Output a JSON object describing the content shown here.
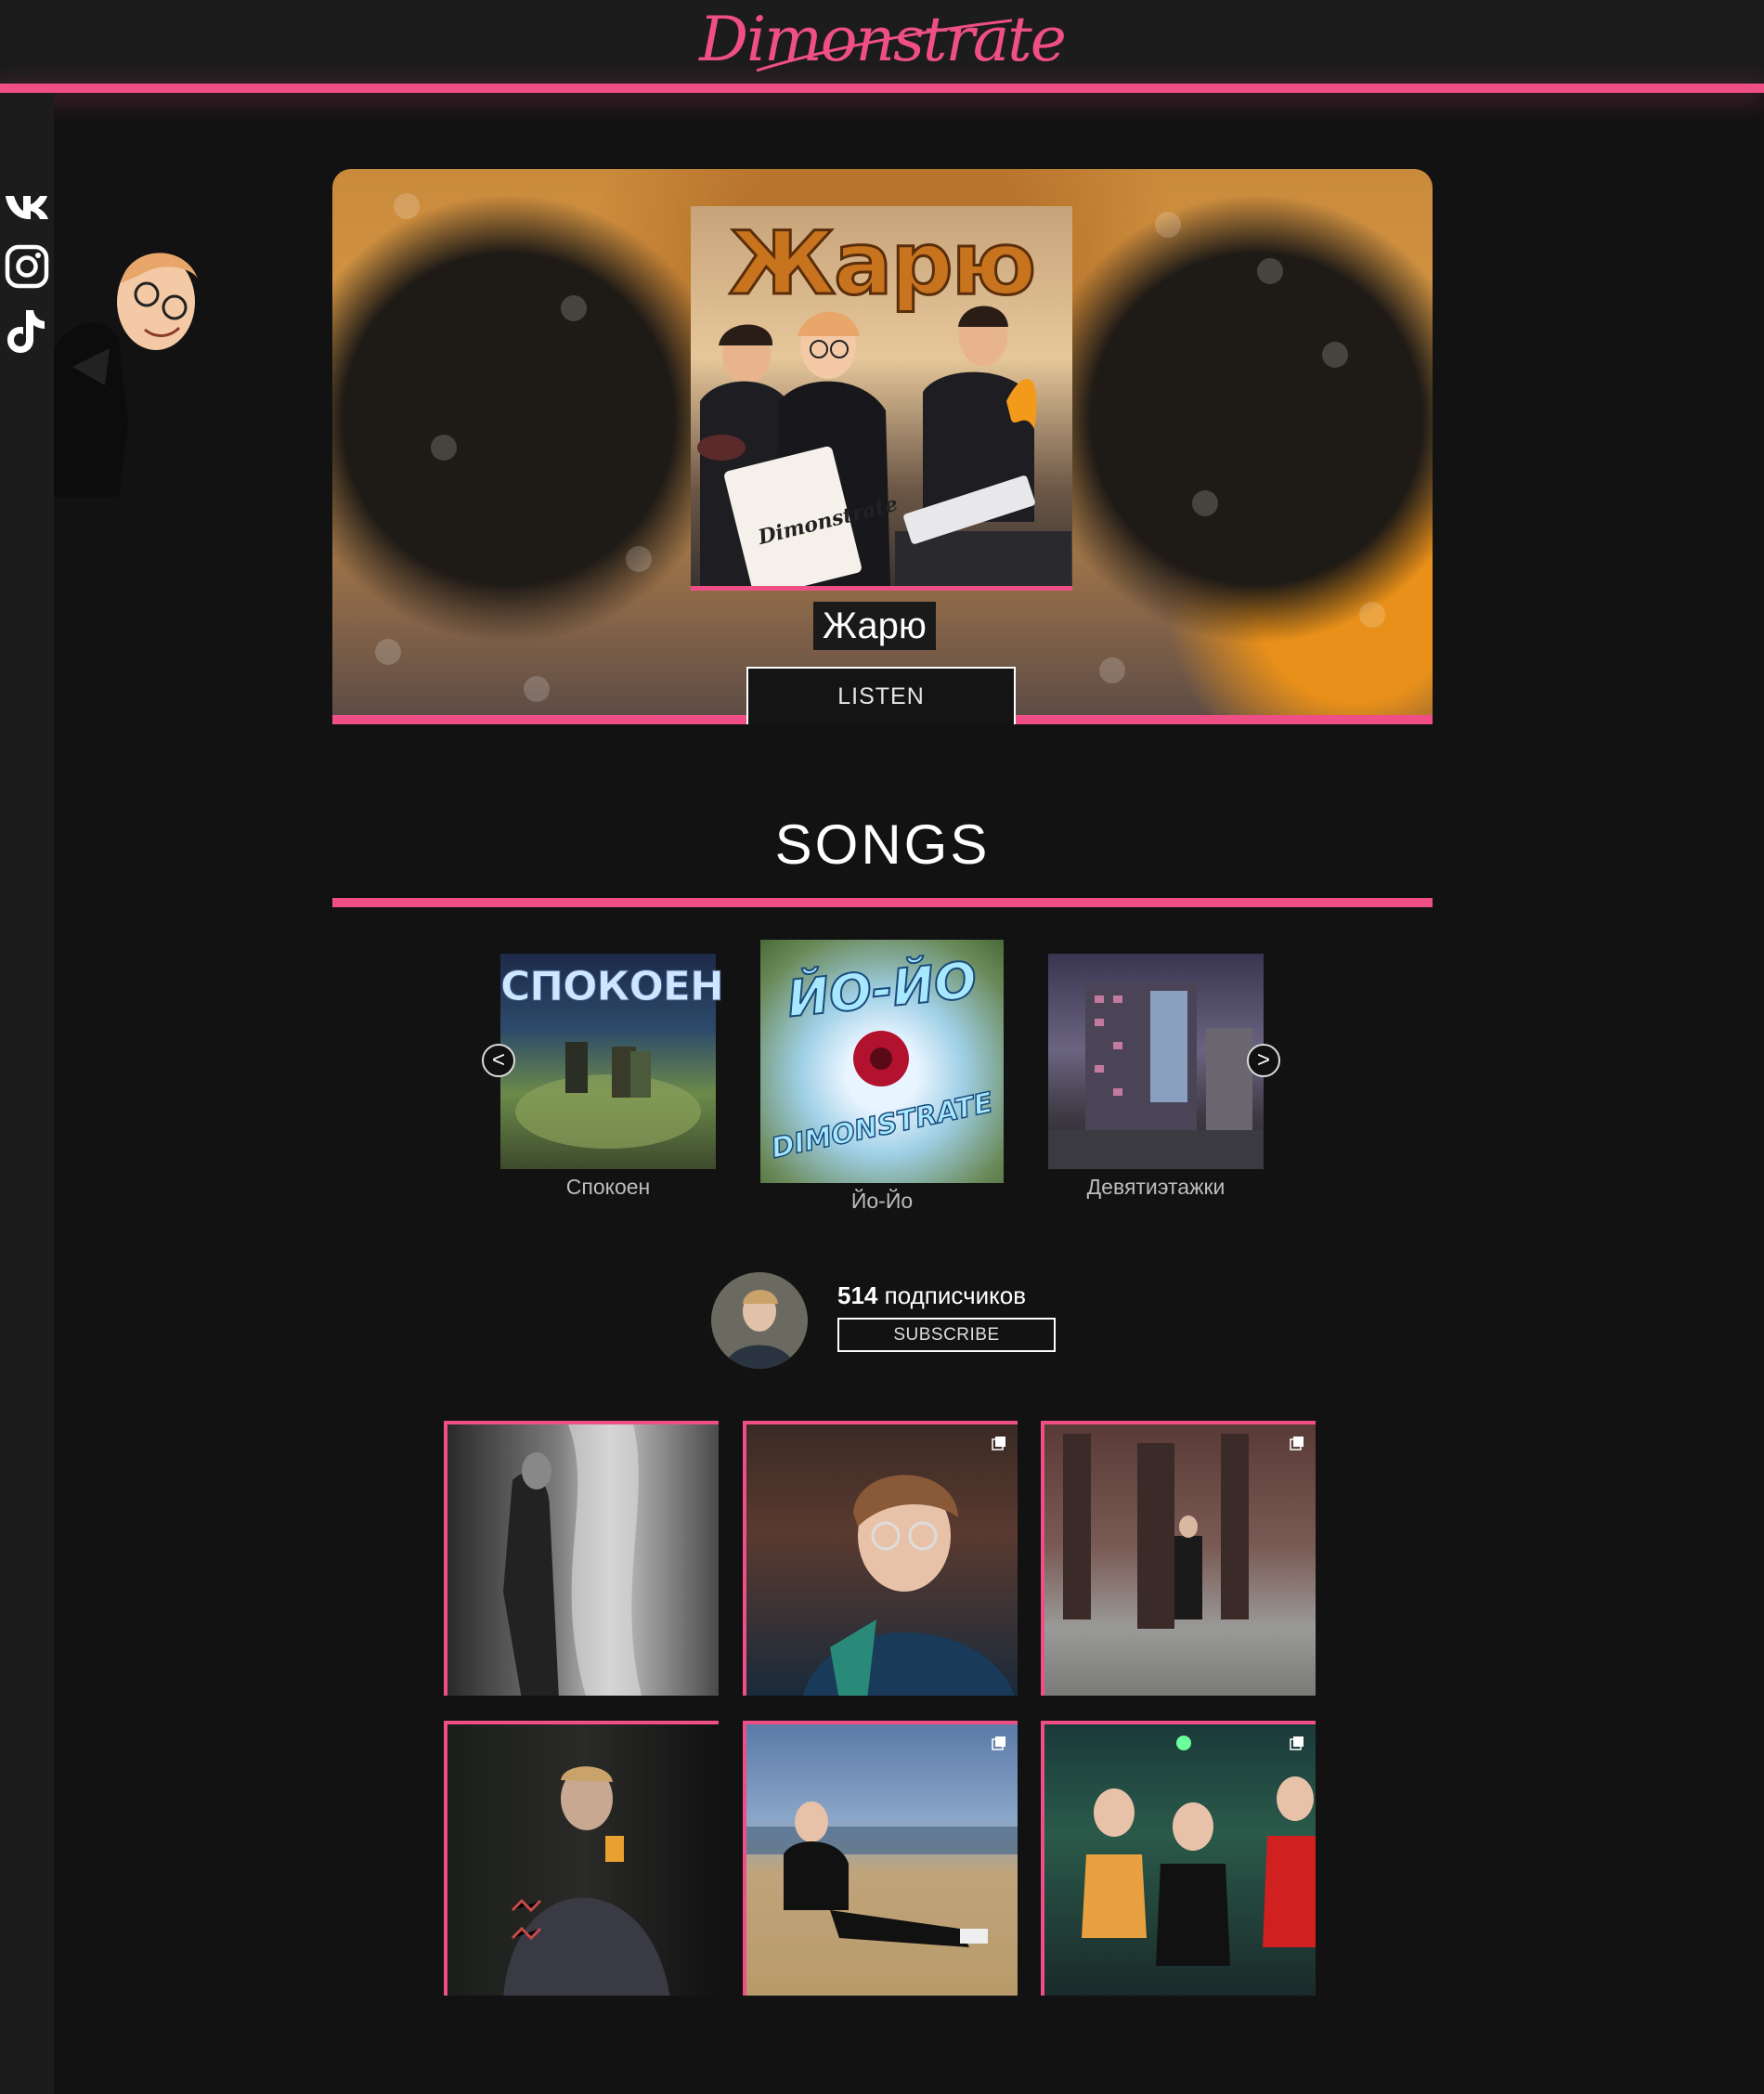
{
  "header": {
    "logo_text": "Dimonstrate",
    "accent": "#ef4f86"
  },
  "social": [
    {
      "name": "vk",
      "label": "VK"
    },
    {
      "name": "instagram",
      "label": "Instagram"
    },
    {
      "name": "tiktok",
      "label": "TikTok"
    }
  ],
  "hero": {
    "cover_text": "Жарю",
    "track_title": "Жарю",
    "listen_label": "LISTEN"
  },
  "songs": {
    "heading": "SONGS",
    "prev_label": "<",
    "next_label": ">",
    "items": [
      {
        "title": "Спокоен",
        "cover_text": "СПОКОЕН"
      },
      {
        "title": "Йо-Йо",
        "cover_text": "ЙО-ЙО"
      },
      {
        "title": "Девятиэтажки",
        "cover_text": ""
      }
    ]
  },
  "subscribe": {
    "count": "514",
    "count_suffix": " подписчиков",
    "button_label": "SUBSCRIBE"
  },
  "gallery": {
    "posts": [
      {
        "id": "post-1",
        "multi": false
      },
      {
        "id": "post-2",
        "multi": true
      },
      {
        "id": "post-3",
        "multi": true
      },
      {
        "id": "post-4",
        "multi": false
      },
      {
        "id": "post-5",
        "multi": true
      },
      {
        "id": "post-6",
        "multi": true
      }
    ]
  }
}
